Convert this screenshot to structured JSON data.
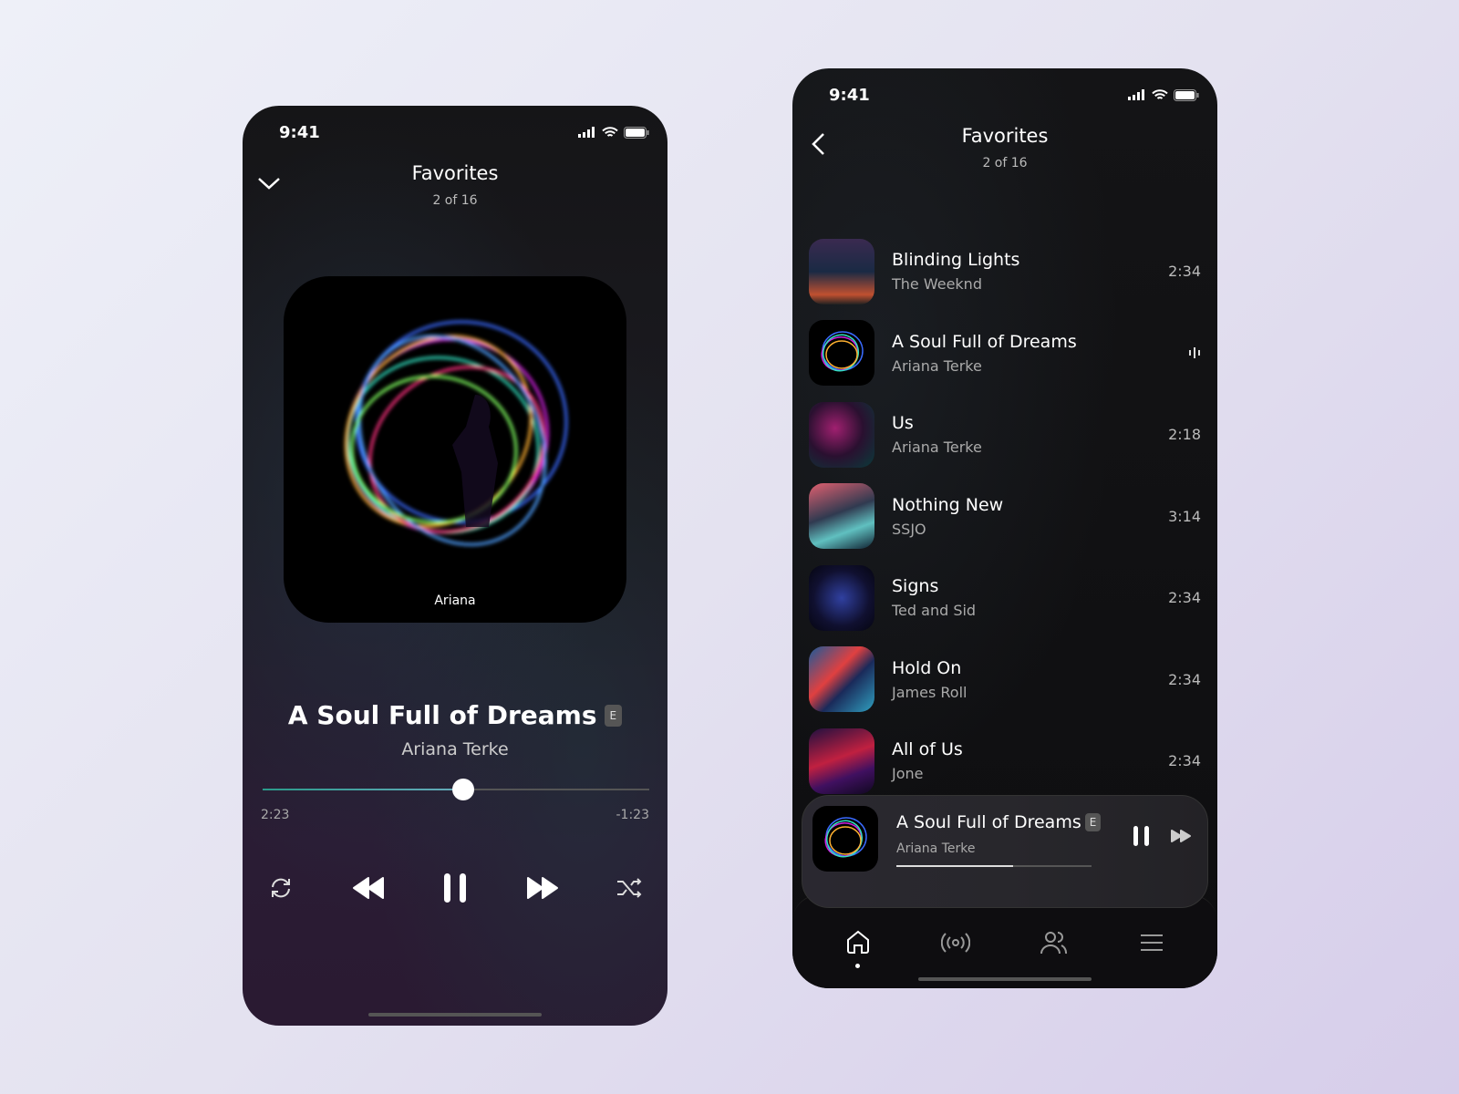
{
  "player": {
    "status_time": "9:41",
    "header": {
      "title": "Favorites",
      "subtitle": "2 of 16"
    },
    "album_label": "Ariana",
    "track": {
      "title": "A Soul Full of Dreams",
      "explicit": "E",
      "artist": "Ariana Terke"
    },
    "progress": {
      "elapsed": "2:23",
      "remaining": "-1:23",
      "fraction": 0.52
    }
  },
  "playlist": {
    "status_time": "9:41",
    "header": {
      "title": "Favorites",
      "subtitle": "2 of 16"
    },
    "tracks": [
      {
        "title": "Blinding Lights",
        "artist": "The Weeknd",
        "duration": "2:34"
      },
      {
        "title": "A Soul Full of Dreams",
        "artist": "Ariana Terke",
        "duration": "",
        "playing": true
      },
      {
        "title": "Us",
        "artist": "Ariana Terke",
        "duration": "2:18"
      },
      {
        "title": "Nothing New",
        "artist": "SSJO",
        "duration": "3:14"
      },
      {
        "title": "Signs",
        "artist": "Ted and Sid",
        "duration": "2:34"
      },
      {
        "title": "Hold On",
        "artist": "James Roll",
        "duration": "2:34"
      },
      {
        "title": "All of Us",
        "artist": "Jone",
        "duration": "2:34"
      }
    ],
    "mini_player": {
      "title": "A Soul Full of Dreams",
      "explicit": "E",
      "artist": "Ariana Terke",
      "progress_fraction": 0.6
    },
    "tabs": [
      {
        "icon": "home-icon",
        "active": true
      },
      {
        "icon": "broadcast-icon"
      },
      {
        "icon": "users-icon"
      },
      {
        "icon": "menu-icon"
      }
    ]
  }
}
